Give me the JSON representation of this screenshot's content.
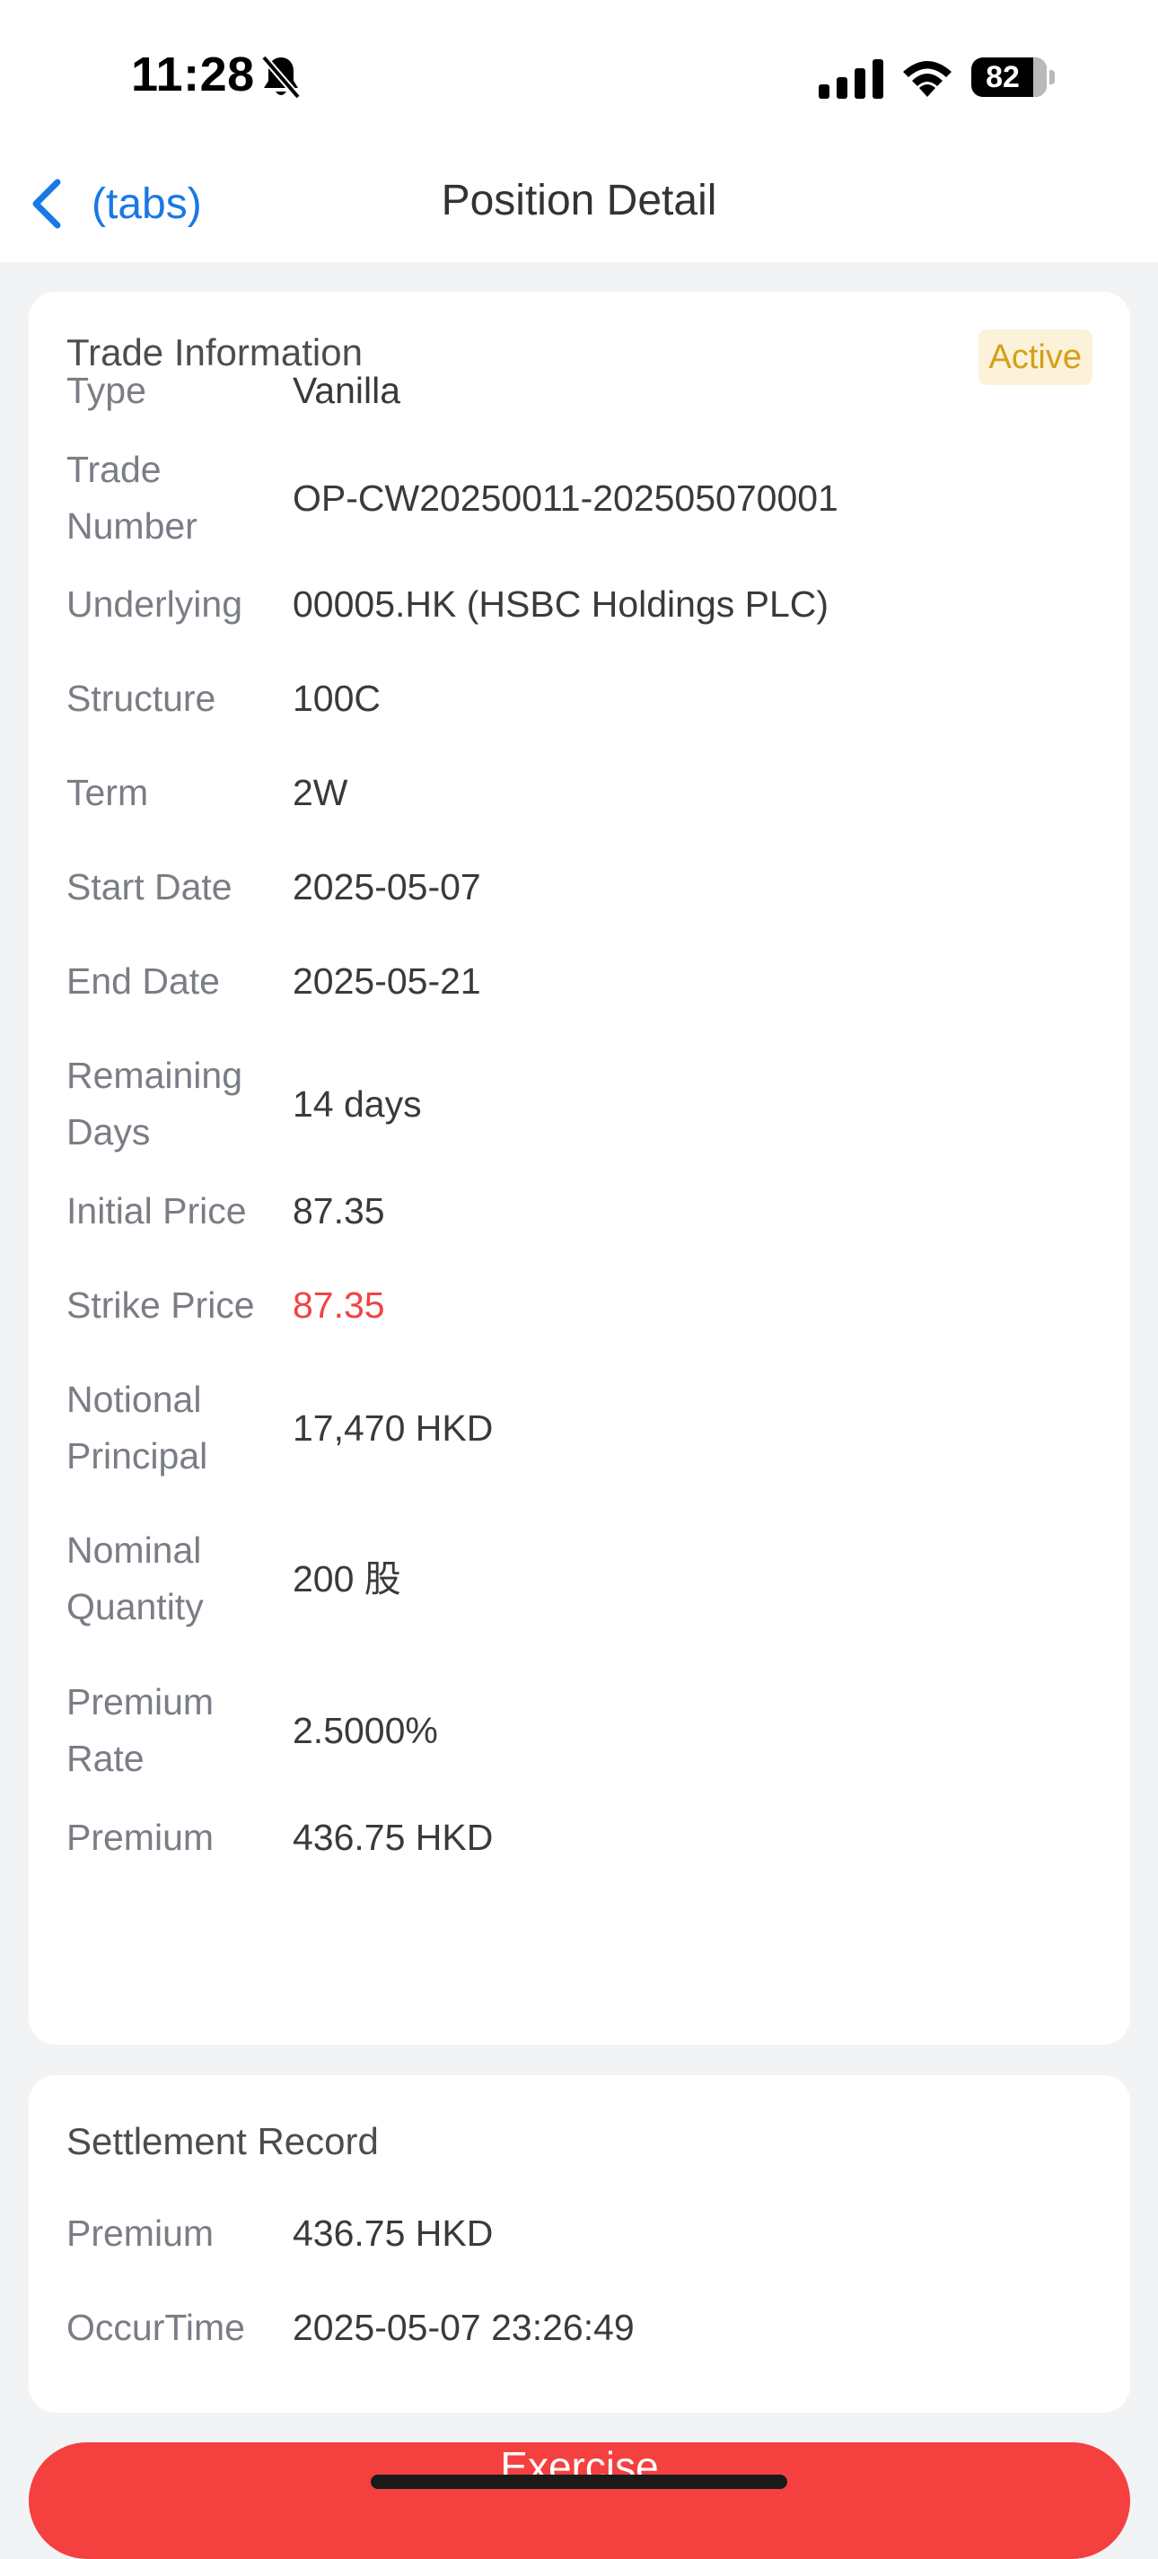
{
  "status_bar": {
    "time": "11:28",
    "battery_level": "82",
    "battery_fraction": 0.82,
    "icons": [
      "bell-slash-icon",
      "cellular-signal-icon",
      "wifi-icon",
      "battery-icon"
    ]
  },
  "nav": {
    "back_label": "(tabs)",
    "title": "Position Detail",
    "back_icon": "chevron-left-icon"
  },
  "trade_info": {
    "title": "Trade Information",
    "status": "Active",
    "rows": [
      {
        "label": "Type",
        "value": "Vanilla"
      },
      {
        "label": "Trade Number",
        "value": "OP-CW20250011-202505070001"
      },
      {
        "label": "Underlying",
        "value": "00005.HK (HSBC Holdings PLC)"
      },
      {
        "label": "Structure",
        "value": "100C"
      },
      {
        "label": "Term",
        "value": "2W"
      },
      {
        "label": "Start Date",
        "value": "2025-05-07"
      },
      {
        "label": "End Date",
        "value": "2025-05-21"
      },
      {
        "label": "Remaining Days",
        "value": "14 days"
      },
      {
        "label": "Initial Price",
        "value": "87.35"
      },
      {
        "label": "Strike Price",
        "value": "87.35"
      },
      {
        "label": "Notional Principal",
        "value": "17,470 HKD"
      },
      {
        "label": "Nominal Quantity",
        "value": "200 股"
      },
      {
        "label": "Premium Rate",
        "value": "2.5000%"
      },
      {
        "label": "Premium",
        "value": "436.75 HKD"
      }
    ]
  },
  "settlement": {
    "title": "Settlement Record",
    "rows": [
      {
        "label": "Premium",
        "value": "436.75 HKD"
      },
      {
        "label": "OccurTime",
        "value": "2025-05-07 23:26:49"
      }
    ]
  },
  "actions": {
    "exercise_label": "Exercise"
  },
  "colors": {
    "accent_blue": "#1a78e6",
    "badge_text": "#d4a017",
    "badge_bg": "#fcf1d9",
    "strike_price": "#f04444",
    "exercise_button": "#f4403f",
    "page_bg": "#f2f3f5"
  }
}
